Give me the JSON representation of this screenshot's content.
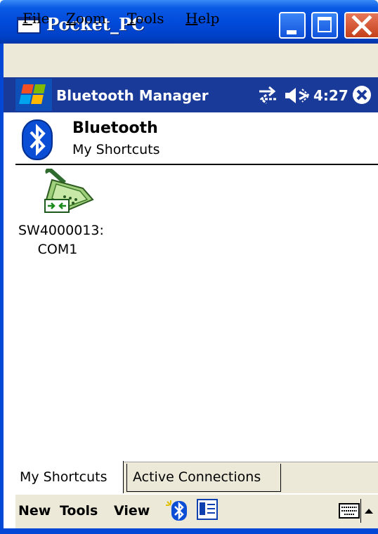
{
  "window": {
    "title": "Pocket_PC"
  },
  "menubar": {
    "items": [
      {
        "key": "F",
        "rest": "ile"
      },
      {
        "key": "Z",
        "rest": "oom"
      },
      {
        "key": "T",
        "rest": "ools"
      },
      {
        "key": "H",
        "rest": "elp"
      }
    ]
  },
  "navbar": {
    "title": "Bluetooth Manager",
    "time": "4:27"
  },
  "header": {
    "title": "Bluetooth",
    "subtitle": "My Shortcuts"
  },
  "shortcuts": [
    {
      "line1": "SW4000013:",
      "line2": "COM1",
      "icon": "serial-port-icon"
    }
  ],
  "tabs": {
    "active": "My Shortcuts",
    "inactive": "Active Connections"
  },
  "commandbar": {
    "new": "New",
    "tools": "Tools",
    "view": "View"
  },
  "colors": {
    "titlebar": "#0149d9",
    "navbar": "#1a3a9a",
    "chrome": "#ece9d8",
    "close": "#c5401b"
  }
}
